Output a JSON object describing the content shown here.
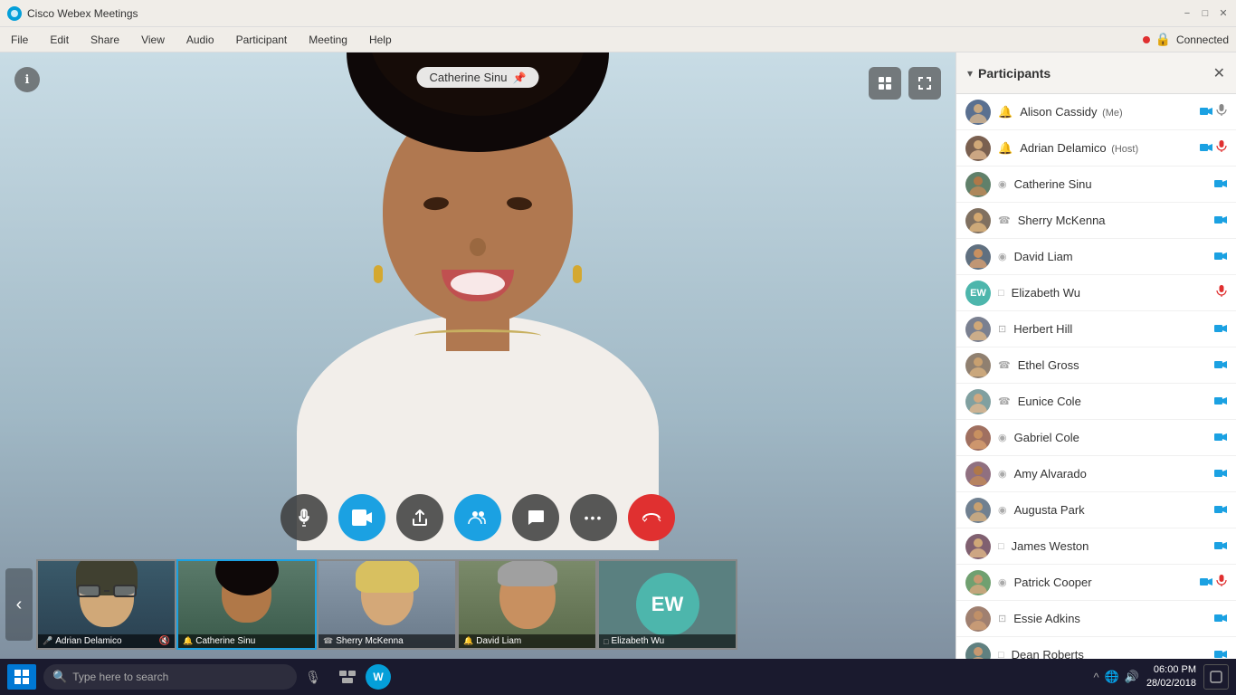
{
  "titlebar": {
    "app_name": "Cisco Webex Meetings",
    "minimize": "−",
    "maximize": "□",
    "close": "✕"
  },
  "menubar": {
    "items": [
      "File",
      "Edit",
      "Share",
      "View",
      "Audio",
      "Participant",
      "Meeting",
      "Help"
    ],
    "connected_text": "Connected"
  },
  "video": {
    "main_speaker": "Catherine Sinu",
    "pin_tooltip": "Pin"
  },
  "controls": {
    "mute_label": "🎤",
    "video_label": "🎥",
    "share_label": "⬆",
    "participants_label": "👥",
    "chat_label": "💬",
    "more_label": "•••",
    "end_label": "✕"
  },
  "thumbnails": [
    {
      "name": "Adrian Delamico",
      "mic": "🎤",
      "muted": true,
      "bg": "#3a5a70"
    },
    {
      "name": "Catherine Sinu",
      "mic": "🔔",
      "muted": false,
      "bg": "#6a8a7a"
    },
    {
      "name": "Sherry McKenna",
      "mic": "☎",
      "muted": false,
      "bg": "#5a6a7a"
    },
    {
      "name": "David Liam",
      "mic": "🔔",
      "muted": false,
      "bg": "#7a8a6a"
    },
    {
      "name": "Elizabeth Wu",
      "mic": "□",
      "muted": false,
      "initials": "EW",
      "bg": "#4db6ac"
    }
  ],
  "participants_panel": {
    "title": "Participants",
    "participants": [
      {
        "name": "Alison Cassidy",
        "badge": "(Me)",
        "host": false,
        "video_icon": true,
        "mic_muted": true,
        "mic_color": "normal",
        "bg": "#5a7090"
      },
      {
        "name": "Adrian Delamico",
        "badge": "(Host)",
        "host": true,
        "video_icon": true,
        "mic_muted": true,
        "mic_color": "red",
        "bg": "#7a6050"
      },
      {
        "name": "Catherine Sinu",
        "badge": "",
        "host": false,
        "video_icon": true,
        "mic_muted": false,
        "bg": "#60806a"
      },
      {
        "name": "Sherry McKenna",
        "badge": "",
        "host": false,
        "video_icon": true,
        "mic_muted": false,
        "bg": "#807060"
      },
      {
        "name": "David Liam",
        "badge": "",
        "host": false,
        "video_icon": true,
        "mic_muted": false,
        "bg": "#607080"
      },
      {
        "name": "Elizabeth Wu",
        "badge": "",
        "host": false,
        "video_icon": false,
        "mic_muted": true,
        "mic_color": "red",
        "initials": "EW",
        "bg": "#4db6ac"
      },
      {
        "name": "Herbert Hill",
        "badge": "",
        "host": false,
        "video_icon": true,
        "mic_muted": false,
        "bg": "#7a8090"
      },
      {
        "name": "Ethel Gross",
        "badge": "",
        "host": false,
        "video_icon": true,
        "mic_muted": false,
        "bg": "#908070"
      },
      {
        "name": "Eunice Cole",
        "badge": "",
        "host": false,
        "video_icon": true,
        "mic_muted": false,
        "bg": "#80a0a0"
      },
      {
        "name": "Gabriel Cole",
        "badge": "",
        "host": false,
        "video_icon": true,
        "mic_muted": false,
        "bg": "#a07060"
      },
      {
        "name": "Amy Alvarado",
        "badge": "",
        "host": false,
        "video_icon": true,
        "mic_muted": false,
        "bg": "#907080"
      },
      {
        "name": "Augusta Park",
        "badge": "",
        "host": false,
        "video_icon": true,
        "mic_muted": false,
        "bg": "#708090"
      },
      {
        "name": "James Weston",
        "badge": "",
        "host": false,
        "video_icon": false,
        "mic_muted": false,
        "bg": "#806070"
      },
      {
        "name": "Patrick Cooper",
        "badge": "",
        "host": false,
        "video_icon": true,
        "mic_muted": true,
        "mic_color": "red",
        "bg": "#70a070"
      },
      {
        "name": "Essie Adkins",
        "badge": "",
        "host": false,
        "video_icon": true,
        "mic_muted": false,
        "bg": "#a08070"
      },
      {
        "name": "Dean Roberts",
        "badge": "",
        "host": false,
        "video_icon": true,
        "mic_muted": false,
        "bg": "#608080"
      }
    ]
  },
  "taskbar": {
    "search_placeholder": "Type here to search",
    "time": "06:00 PM",
    "date": "28/02/2018"
  }
}
